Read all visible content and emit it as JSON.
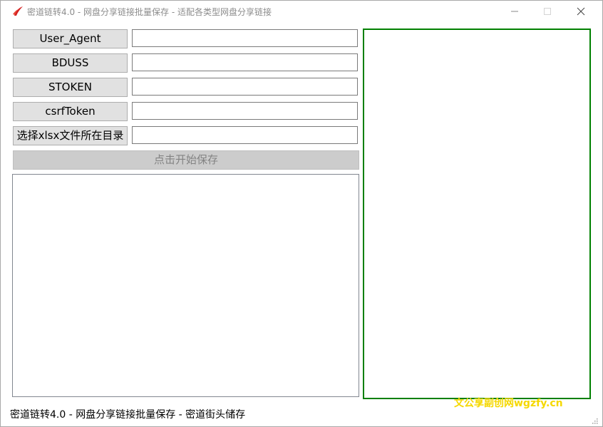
{
  "window": {
    "title": "密道链转4.0 - 网盘分享链接批量保存 - 适配各类型网盘分享链接",
    "app_icon": "red-swoosh-icon",
    "controls": [
      "minimize-icon",
      "maximize-icon",
      "close-icon"
    ]
  },
  "form": {
    "fields": [
      {
        "label": "User_Agent",
        "value": ""
      },
      {
        "label": "BDUSS",
        "value": ""
      },
      {
        "label": "STOKEN",
        "value": ""
      },
      {
        "label": "csrfToken",
        "value": ""
      },
      {
        "label": "选择xlsx文件所在目录",
        "value": ""
      }
    ],
    "start_button": "点击开始保存"
  },
  "log": {
    "text": ""
  },
  "status_bar": {
    "text": "密道链转4.0 - 网盘分享链接批量保存 - 密道街头储存"
  },
  "watermark": {
    "text": "文公享副创网wgzfy.cn"
  },
  "colors": {
    "preview_border": "#008000",
    "button_bg": "#e1e1e1",
    "disabled_button_bg": "#cccccc",
    "watermark": "#f5d800"
  }
}
